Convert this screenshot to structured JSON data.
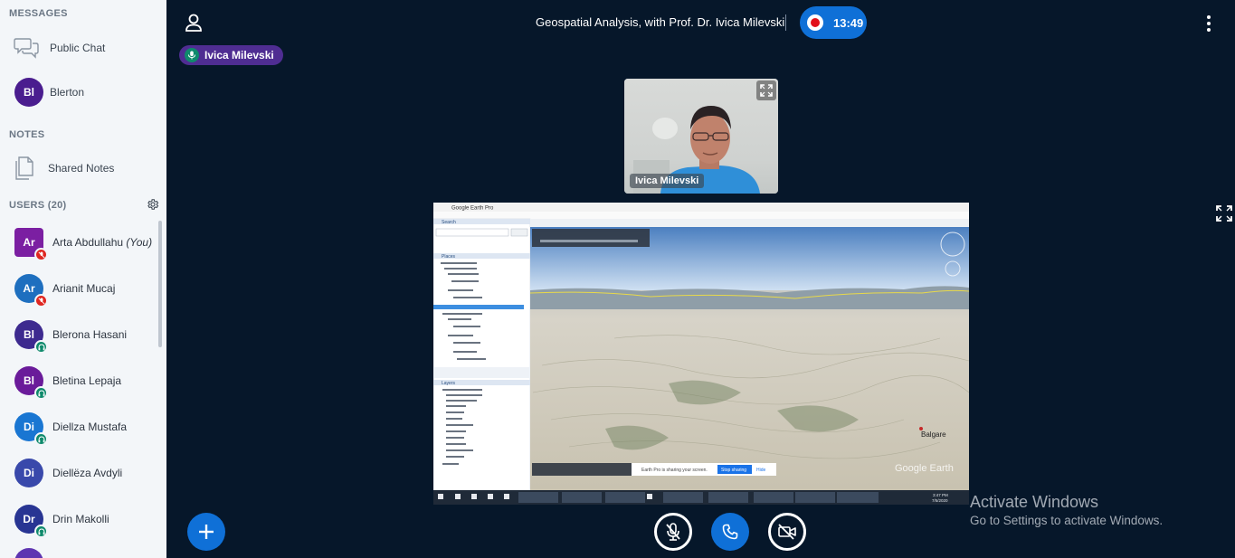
{
  "sidebar": {
    "messages_heading": "MESSAGES",
    "public_chat_label": "Public Chat",
    "private_chat": {
      "initials": "Bl",
      "name": "Blerton",
      "color": "#4a1d8f"
    },
    "notes_heading": "NOTES",
    "shared_notes_label": "Shared Notes",
    "users_heading": "USERS (20)",
    "users": [
      {
        "initials": "Ar",
        "name": "Arta Abdullahu",
        "suffix": "(You)",
        "color": "#7b1fa2",
        "status": "muted",
        "square": true
      },
      {
        "initials": "Ar",
        "name": "Arianit Mucaj",
        "suffix": "",
        "color": "#1e6fbf",
        "status": "muted",
        "square": false
      },
      {
        "initials": "Bl",
        "name": "Blerona Hasani",
        "suffix": "",
        "color": "#3d2a8f",
        "status": "listen",
        "square": false
      },
      {
        "initials": "Bl",
        "name": "Bletina Lepaja",
        "suffix": "",
        "color": "#6a1b9a",
        "status": "listen",
        "square": false
      },
      {
        "initials": "Di",
        "name": "Diellza Mustafa",
        "suffix": "",
        "color": "#1976d2",
        "status": "listen",
        "square": false
      },
      {
        "initials": "Di",
        "name": "Diellëza Avdyli",
        "suffix": "",
        "color": "#3949ab",
        "status": "",
        "square": false
      },
      {
        "initials": "Dr",
        "name": "Drin Makolli",
        "suffix": "",
        "color": "#283593",
        "status": "listen",
        "square": false
      }
    ]
  },
  "header": {
    "session_title": "Geospatial Analysis, with Prof. Dr. Ivica Milevski",
    "record_time": "13:49",
    "record_color": "#0f70d7"
  },
  "talker": {
    "name": "Ivica Milevski"
  },
  "webcam": {
    "name": "Ivica Milevski"
  },
  "screenshare": {
    "title": "Google Earth Pro",
    "search_heading": "Search",
    "places_heading": "Places",
    "layers_heading": "Layers",
    "place_label": "Balgare",
    "watermark": "Google Earth",
    "sharing_text": "Earth Pro is sharing your screen.",
    "stop_sharing": "Stop sharing",
    "hide": "Hide",
    "clock_time": "3:47 PM",
    "clock_date": "7/5/2020"
  },
  "activate_windows": {
    "title": "Activate Windows",
    "subtitle": "Go to Settings to activate Windows."
  },
  "icons": {
    "user_menu": "user-icon",
    "more": "more-vertical-icon",
    "actions": "plus-icon",
    "mute": "microphone-off-icon",
    "phone": "phone-icon",
    "camera": "camera-off-icon"
  }
}
